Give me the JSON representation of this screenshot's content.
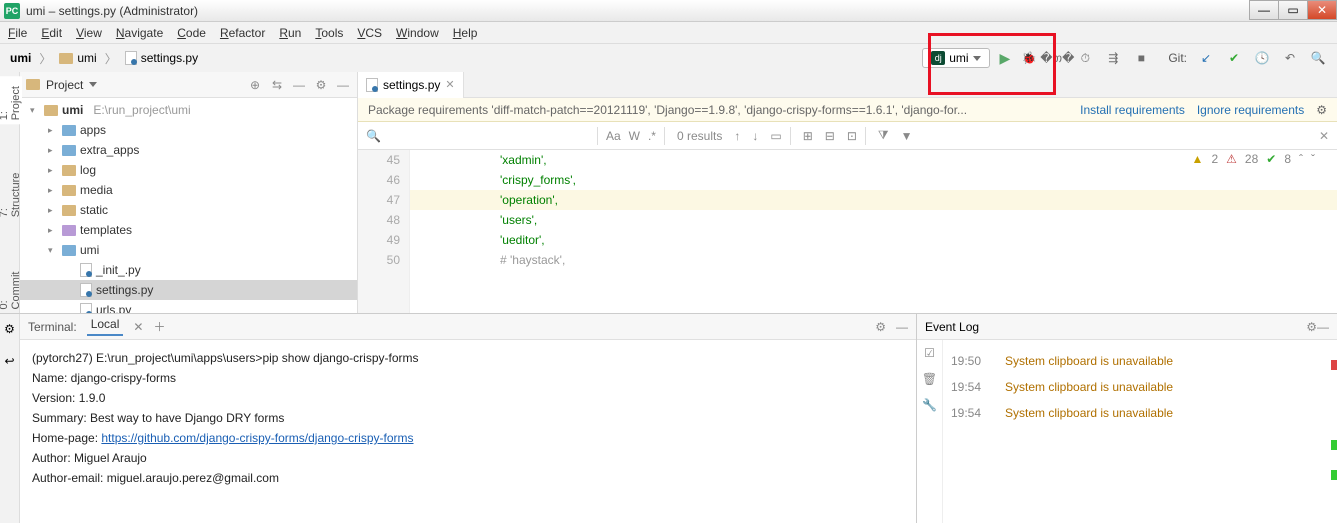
{
  "title": "umi – settings.py (Administrator)",
  "menu": [
    "File",
    "Edit",
    "View",
    "Navigate",
    "Code",
    "Refactor",
    "Run",
    "Tools",
    "VCS",
    "Window",
    "Help"
  ],
  "breadcrumb": {
    "root": "umi",
    "mid": "umi",
    "file": "settings.py"
  },
  "runconfig": "umi",
  "git_label": "Git:",
  "left_tabs": {
    "project": "1: Project",
    "structure": "7: Structure",
    "commit": "0: Commit"
  },
  "project": {
    "header": "Project",
    "root": {
      "name": "umi",
      "path": "E:\\run_project\\umi"
    },
    "nodes": [
      {
        "name": "apps",
        "kind": "folder-blue",
        "depth": 1,
        "arrow": "▸"
      },
      {
        "name": "extra_apps",
        "kind": "folder-blue",
        "depth": 1,
        "arrow": "▸"
      },
      {
        "name": "log",
        "kind": "folder",
        "depth": 1,
        "arrow": "▸"
      },
      {
        "name": "media",
        "kind": "folder",
        "depth": 1,
        "arrow": "▸"
      },
      {
        "name": "static",
        "kind": "folder",
        "depth": 1,
        "arrow": "▸"
      },
      {
        "name": "templates",
        "kind": "folder-purple",
        "depth": 1,
        "arrow": "▸"
      },
      {
        "name": "umi",
        "kind": "folder-blue",
        "depth": 1,
        "arrow": "▾"
      },
      {
        "name": "_init_.py",
        "kind": "py",
        "depth": 2,
        "arrow": ""
      },
      {
        "name": "settings.py",
        "kind": "py",
        "depth": 2,
        "arrow": "",
        "sel": true
      },
      {
        "name": "urls.py",
        "kind": "py",
        "depth": 2,
        "arrow": ""
      }
    ]
  },
  "editor": {
    "tab": "settings.py",
    "banner_msg": "Package requirements 'diff-match-patch==20121119', 'Django==1.9.8', 'django-crispy-forms==1.6.1', 'django-for...",
    "banner_install": "Install requirements",
    "banner_ignore": "Ignore requirements",
    "find_results": "0 results",
    "lines": [
      {
        "n": 45,
        "t": "'xadmin',",
        "c": "str"
      },
      {
        "n": 46,
        "t": "'crispy_forms',",
        "c": "str"
      },
      {
        "n": 47,
        "t": "'operation',",
        "c": "str",
        "hl": true
      },
      {
        "n": 48,
        "t": "'users',",
        "c": "str"
      },
      {
        "n": 49,
        "t": "'ueditor',",
        "c": "str"
      },
      {
        "n": 50,
        "t": "# 'haystack',",
        "c": "cmt"
      }
    ],
    "inspections": {
      "warn": "2",
      "weak": "28",
      "typo": "8"
    }
  },
  "terminal": {
    "title": "Terminal:",
    "tab": "Local",
    "lines": [
      {
        "t": "(pytorch27) E:\\run_project\\umi\\apps\\users>pip show django-crispy-forms"
      },
      {
        "t": "Name: django-crispy-forms"
      },
      {
        "t": "Version: 1.9.0"
      },
      {
        "t": "Summary: Best way to have Django DRY forms"
      },
      {
        "pre": "Home-page: ",
        "link": "https://github.com/django-crispy-forms/django-crispy-forms"
      },
      {
        "t": "Author: Miguel Araujo"
      },
      {
        "t": "Author-email: miguel.araujo.perez@gmail.com"
      }
    ]
  },
  "eventlog": {
    "title": "Event Log",
    "rows": [
      {
        "time": "19:50",
        "msg": "System clipboard is unavailable"
      },
      {
        "time": "19:54",
        "msg": "System clipboard is unavailable"
      },
      {
        "time": "19:54",
        "msg": "System clipboard is unavailable"
      }
    ]
  }
}
